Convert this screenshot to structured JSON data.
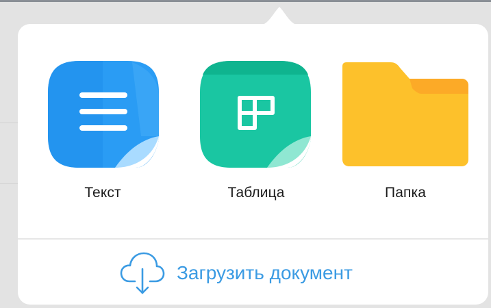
{
  "menu": {
    "items": [
      {
        "label": "Текст",
        "icon": "text-document-icon",
        "color": "#2a9cf4"
      },
      {
        "label": "Таблица",
        "icon": "spreadsheet-icon",
        "color": "#1ac6a2"
      },
      {
        "label": "Папка",
        "icon": "folder-icon",
        "color": "#fdc12b"
      }
    ],
    "upload": {
      "label": "Загрузить документ",
      "icon": "cloud-download-icon",
      "color": "#3b9be3"
    }
  }
}
